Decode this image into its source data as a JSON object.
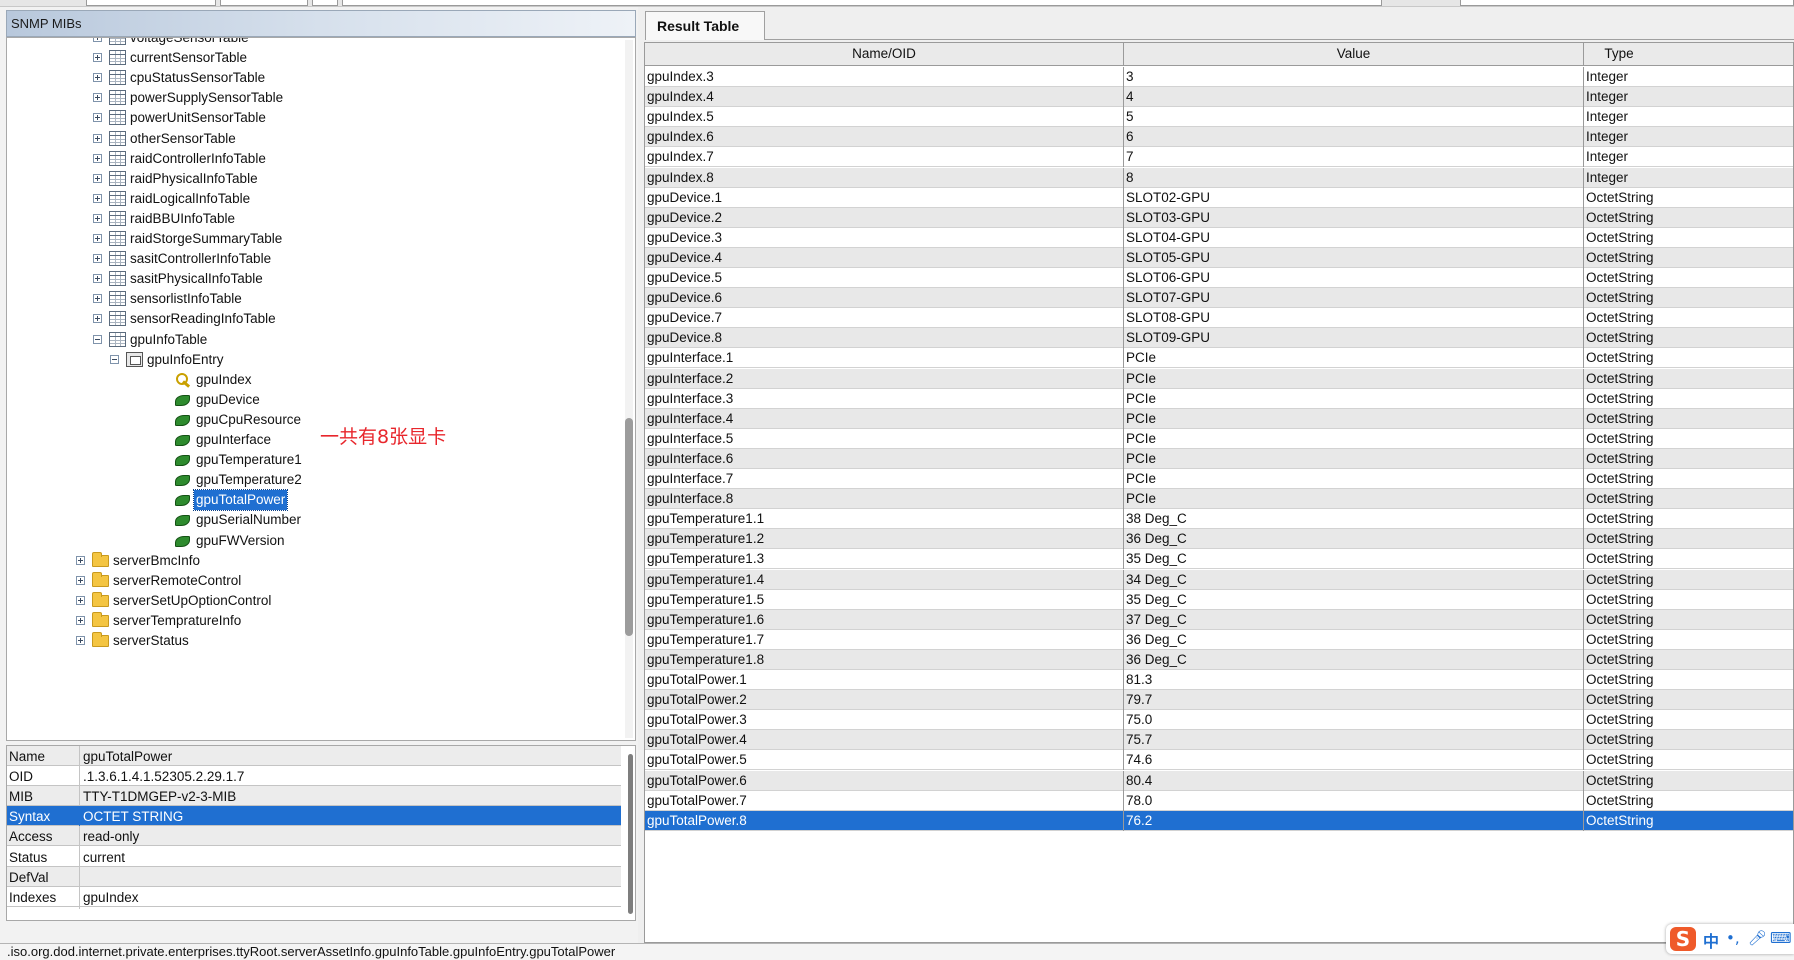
{
  "left": {
    "header_title": "SNMP MIBs",
    "tree": [
      {
        "label": "voltageSensorTable",
        "icon": "table-icon",
        "expander": "plus"
      },
      {
        "label": "currentSensorTable",
        "icon": "table-icon",
        "expander": "plus"
      },
      {
        "label": "cpuStatusSensorTable",
        "icon": "table-icon",
        "expander": "plus"
      },
      {
        "label": "powerSupplySensorTable",
        "icon": "table-icon",
        "expander": "plus"
      },
      {
        "label": "powerUnitSensorTable",
        "icon": "table-icon",
        "expander": "plus"
      },
      {
        "label": "otherSensorTable",
        "icon": "table-icon",
        "expander": "plus"
      },
      {
        "label": "raidControllerInfoTable",
        "icon": "table-icon",
        "expander": "plus"
      },
      {
        "label": "raidPhysicalInfoTable",
        "icon": "table-icon",
        "expander": "plus"
      },
      {
        "label": "raidLogicalInfoTable",
        "icon": "table-icon",
        "expander": "plus"
      },
      {
        "label": "raidBBUInfoTable",
        "icon": "table-icon",
        "expander": "plus"
      },
      {
        "label": "raidStorgeSummaryTable",
        "icon": "table-icon",
        "expander": "plus"
      },
      {
        "label": "sasitControllerInfoTable",
        "icon": "table-icon",
        "expander": "plus"
      },
      {
        "label": "sasitPhysicalInfoTable",
        "icon": "table-icon",
        "expander": "plus"
      },
      {
        "label": "sensorlistInfoTable",
        "icon": "table-icon",
        "expander": "plus"
      },
      {
        "label": "sensorReadingInfoTable",
        "icon": "table-icon",
        "expander": "plus"
      },
      {
        "label": "gpuInfoTable",
        "icon": "table-icon",
        "expander": "minus"
      },
      {
        "label": "gpuInfoEntry",
        "icon": "entry-icon",
        "expander": "minus"
      },
      {
        "label": "gpuIndex",
        "icon": "key-icon",
        "expander": ""
      },
      {
        "label": "gpuDevice",
        "icon": "leaf-icon",
        "expander": ""
      },
      {
        "label": "gpuCpuResource",
        "icon": "leaf-icon",
        "expander": ""
      },
      {
        "label": "gpuInterface",
        "icon": "leaf-icon",
        "expander": ""
      },
      {
        "label": "gpuTemperature1",
        "icon": "leaf-icon",
        "expander": ""
      },
      {
        "label": "gpuTemperature2",
        "icon": "leaf-icon",
        "expander": ""
      },
      {
        "label": "gpuTotalPower",
        "icon": "leaf-icon",
        "expander": "",
        "selected": true
      },
      {
        "label": "gpuSerialNumber",
        "icon": "leaf-icon",
        "expander": ""
      },
      {
        "label": "gpuFWVersion",
        "icon": "leaf-icon",
        "expander": ""
      },
      {
        "label": "serverBmcInfo",
        "icon": "folder-icon",
        "expander": "plus"
      },
      {
        "label": "serverRemoteControl",
        "icon": "folder-icon",
        "expander": "plus"
      },
      {
        "label": "serverSetUpOptionControl",
        "icon": "folder-icon",
        "expander": "plus"
      },
      {
        "label": "serverTempratureInfo",
        "icon": "folder-icon",
        "expander": "plus"
      },
      {
        "label": "serverStatus",
        "icon": "folder-icon",
        "expander": "plus"
      }
    ],
    "annotation": "一共有8张显卡",
    "properties": [
      {
        "key": "Name",
        "value": "gpuTotalPower"
      },
      {
        "key": "OID",
        "value": ".1.3.6.1.4.1.52305.2.29.1.7"
      },
      {
        "key": "MIB",
        "value": "TTY-T1DMGEP-v2-3-MIB"
      },
      {
        "key": "Syntax",
        "value": "OCTET STRING",
        "selected": true
      },
      {
        "key": "Access",
        "value": "read-only"
      },
      {
        "key": "Status",
        "value": "current"
      },
      {
        "key": "DefVal",
        "value": ""
      },
      {
        "key": "Indexes",
        "value": "gpuIndex"
      }
    ]
  },
  "right": {
    "tab_label": "Result Table",
    "columns": [
      "Name/OID",
      "Value",
      "Type"
    ],
    "rows": [
      [
        "gpuIndex.3",
        "3",
        "Integer"
      ],
      [
        "gpuIndex.4",
        "4",
        "Integer"
      ],
      [
        "gpuIndex.5",
        "5",
        "Integer"
      ],
      [
        "gpuIndex.6",
        "6",
        "Integer"
      ],
      [
        "gpuIndex.7",
        "7",
        "Integer"
      ],
      [
        "gpuIndex.8",
        "8",
        "Integer"
      ],
      [
        "gpuDevice.1",
        "SLOT02-GPU",
        "OctetString"
      ],
      [
        "gpuDevice.2",
        "SLOT03-GPU",
        "OctetString"
      ],
      [
        "gpuDevice.3",
        "SLOT04-GPU",
        "OctetString"
      ],
      [
        "gpuDevice.4",
        "SLOT05-GPU",
        "OctetString"
      ],
      [
        "gpuDevice.5",
        "SLOT06-GPU",
        "OctetString"
      ],
      [
        "gpuDevice.6",
        "SLOT07-GPU",
        "OctetString"
      ],
      [
        "gpuDevice.7",
        "SLOT08-GPU",
        "OctetString"
      ],
      [
        "gpuDevice.8",
        "SLOT09-GPU",
        "OctetString"
      ],
      [
        "gpuInterface.1",
        "PCIe",
        "OctetString"
      ],
      [
        "gpuInterface.2",
        "PCIe",
        "OctetString"
      ],
      [
        "gpuInterface.3",
        "PCIe",
        "OctetString"
      ],
      [
        "gpuInterface.4",
        "PCIe",
        "OctetString"
      ],
      [
        "gpuInterface.5",
        "PCIe",
        "OctetString"
      ],
      [
        "gpuInterface.6",
        "PCIe",
        "OctetString"
      ],
      [
        "gpuInterface.7",
        "PCIe",
        "OctetString"
      ],
      [
        "gpuInterface.8",
        "PCIe",
        "OctetString"
      ],
      [
        "gpuTemperature1.1",
        "38 Deg_C",
        "OctetString"
      ],
      [
        "gpuTemperature1.2",
        "36 Deg_C",
        "OctetString"
      ],
      [
        "gpuTemperature1.3",
        "35 Deg_C",
        "OctetString"
      ],
      [
        "gpuTemperature1.4",
        "34 Deg_C",
        "OctetString"
      ],
      [
        "gpuTemperature1.5",
        "35 Deg_C",
        "OctetString"
      ],
      [
        "gpuTemperature1.6",
        "37 Deg_C",
        "OctetString"
      ],
      [
        "gpuTemperature1.7",
        "36 Deg_C",
        "OctetString"
      ],
      [
        "gpuTemperature1.8",
        "36 Deg_C",
        "OctetString"
      ],
      [
        "gpuTotalPower.1",
        "81.3",
        "OctetString"
      ],
      [
        "gpuTotalPower.2",
        "79.7",
        "OctetString"
      ],
      [
        "gpuTotalPower.3",
        "75.0",
        "OctetString"
      ],
      [
        "gpuTotalPower.4",
        "75.7",
        "OctetString"
      ],
      [
        "gpuTotalPower.5",
        "74.6",
        "OctetString"
      ],
      [
        "gpuTotalPower.6",
        "80.4",
        "OctetString"
      ],
      [
        "gpuTotalPower.7",
        "78.0",
        "OctetString"
      ],
      [
        "gpuTotalPower.8",
        "76.2",
        "OctetString"
      ]
    ],
    "selected_row": 37
  },
  "status_bar": ".iso.org.dod.internet.private.enterprises.ttyRoot.serverAssetInfo.gpuInfoTable.gpuInfoEntry.gpuTotalPower",
  "ime": {
    "logo": "S",
    "lang": "中",
    "punct": "•,",
    "mic_icon": "mic-icon",
    "keyboard_icon": "keyboard-icon"
  },
  "colors": {
    "selection": "#1f6fd1",
    "annotation": "#e8262c"
  }
}
